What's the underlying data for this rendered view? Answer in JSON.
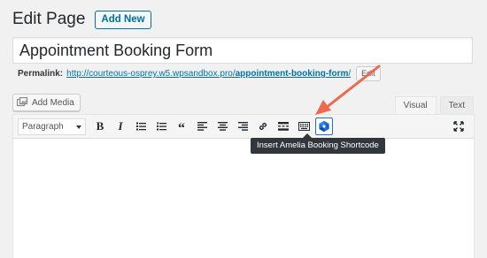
{
  "header": {
    "title": "Edit Page",
    "add_new_label": "Add New"
  },
  "title_field": {
    "value": "Appointment Booking Form"
  },
  "permalink": {
    "label": "Permalink:",
    "url_base": "http://courteous-osprey.w5.wpsandbox.pro/",
    "slug": "appointment-booking-form",
    "url_suffix": "/",
    "edit_label": "Edit"
  },
  "media": {
    "add_media_label": "Add Media",
    "icon": "media-icon"
  },
  "editor_tabs": [
    {
      "label": "Visual",
      "active": true
    },
    {
      "label": "Text",
      "active": false
    }
  ],
  "toolbar": {
    "format_select_value": "Paragraph",
    "bold_label": "B",
    "italic_label": "I",
    "quote_label": "“",
    "buttons": [
      "bold",
      "italic",
      "bulleted-list",
      "numbered-list",
      "blockquote",
      "align-left",
      "align-center",
      "align-right",
      "insert-link",
      "read-more",
      "toolbar-toggle",
      "amelia-shortcode",
      "fullscreen"
    ],
    "amelia_tooltip": "Insert Amelia Booking Shortcode"
  },
  "colors": {
    "accent": "#0071a1",
    "link": "#0073aa",
    "annotation_arrow": "#ee6a4f",
    "amelia_blue": "#1e6fd8"
  }
}
